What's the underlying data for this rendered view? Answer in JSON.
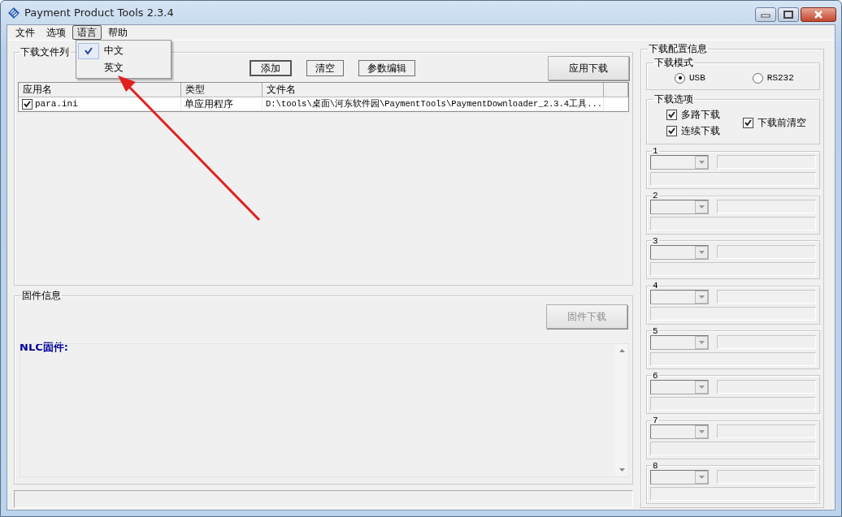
{
  "window": {
    "title": "Payment Product Tools 2.3.4"
  },
  "menu": [
    {
      "label": "文件",
      "selected": false
    },
    {
      "label": "选项",
      "selected": false
    },
    {
      "label": "语言",
      "selected": true
    },
    {
      "label": "帮助",
      "selected": false
    }
  ],
  "dropdown": {
    "items": [
      {
        "label": "中文",
        "checked": true
      },
      {
        "label": "英文",
        "checked": false
      }
    ]
  },
  "download_list": {
    "title": "下载文件列",
    "buttons": [
      {
        "label": "添加",
        "kind": "default"
      },
      {
        "label": "清空",
        "kind": "normal"
      },
      {
        "label": "参数编辑",
        "kind": "normal"
      }
    ],
    "apply_button": "应用下载",
    "columns": [
      "应用名",
      "类型",
      "文件名"
    ],
    "rows": [
      {
        "checked": true,
        "cells": [
          "para.ini",
          "单应用程序",
          "D:\\tools\\桌面\\河东软件园\\PaymentTools\\PaymentDownloader_2.3.4工具..."
        ]
      }
    ]
  },
  "firmware": {
    "title": "固件信息",
    "button": {
      "label": "固件下载",
      "disabled": true
    },
    "label": "NLC固件:"
  },
  "config": {
    "title": "下载配置信息",
    "mode": {
      "title": "下载模式",
      "options": [
        {
          "label": "USB",
          "selected": true
        },
        {
          "label": "RS232",
          "selected": false
        }
      ]
    },
    "options": {
      "title": "下载选项",
      "items": [
        {
          "label": "多路下载",
          "checked": true
        },
        {
          "label": "连续下载",
          "checked": true
        },
        {
          "label": "下载前清空",
          "checked": true
        }
      ]
    },
    "slots": [
      {
        "label": "1"
      },
      {
        "label": "2"
      },
      {
        "label": "3"
      },
      {
        "label": "4"
      },
      {
        "label": "5"
      },
      {
        "label": "6"
      },
      {
        "label": "7"
      },
      {
        "label": "8"
      }
    ]
  }
}
